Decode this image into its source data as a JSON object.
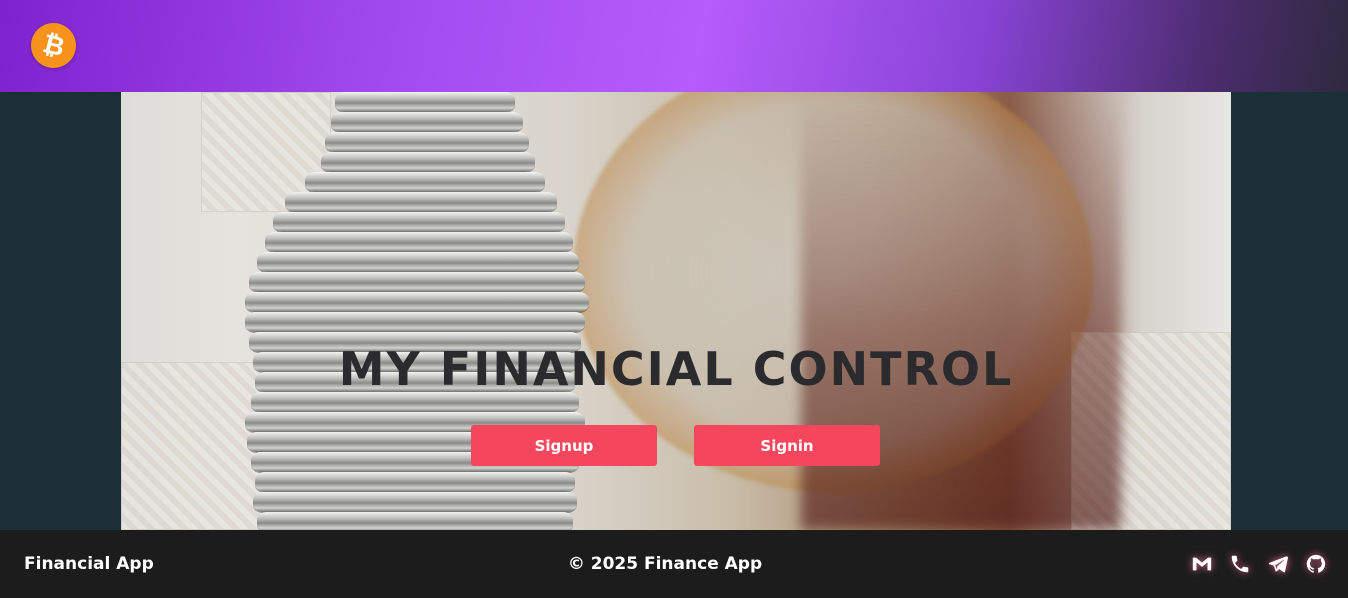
{
  "header": {
    "logo_symbol": "₿",
    "logo_icon": "bitcoin-icon",
    "gradient_colors": [
      "#7e22ce",
      "#b55cfa",
      "#2f2a3f"
    ]
  },
  "hero": {
    "title": "MY FINANCIAL CONTROL",
    "signup_label": "Signup",
    "signin_label": "Signin",
    "button_color": "#f4475e"
  },
  "footer": {
    "brand": "Financial App",
    "copyright": "© 2025 Finance App",
    "icons": [
      "gmail-icon",
      "phone-icon",
      "telegram-icon",
      "github-icon"
    ]
  }
}
